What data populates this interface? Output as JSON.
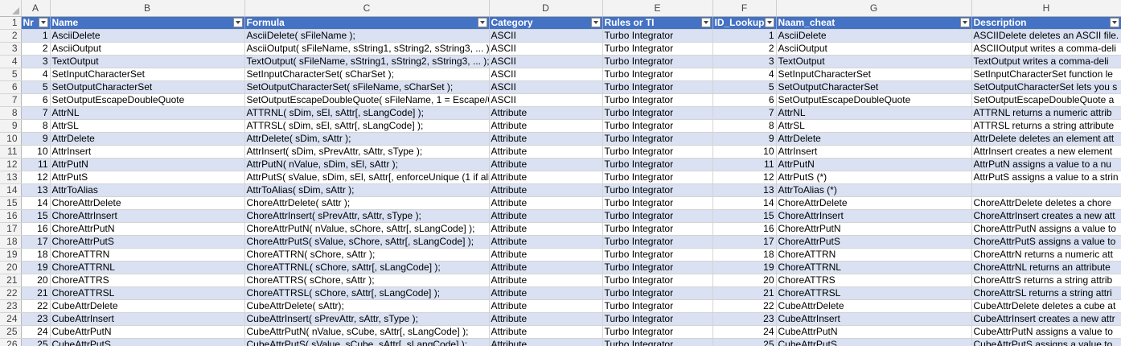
{
  "sheet": {
    "column_letters": [
      "A",
      "B",
      "C",
      "D",
      "E",
      "F",
      "G",
      "H"
    ],
    "header_row_number": "1",
    "headers": [
      "Nr",
      "Name",
      "Formula",
      "Category",
      "Rules or TI",
      "ID_Lookup",
      "Naam_cheat",
      "Description"
    ],
    "rows": [
      {
        "n": "2",
        "cells": [
          "1",
          "AsciiDelete",
          "AsciiDelete( sFileName );",
          "ASCII",
          "Turbo Integrator",
          "1",
          "AsciiDelete",
          "ASCIIDelete deletes an ASCII file."
        ]
      },
      {
        "n": "3",
        "cells": [
          "2",
          "AsciiOutput",
          "AsciiOutput( sFileName, sString1, sString2, sString3, ... );",
          "ASCII",
          "Turbo Integrator",
          "2",
          "AsciiOutput",
          "ASCIIOutput writes a comma-deli"
        ]
      },
      {
        "n": "4",
        "cells": [
          "3",
          "TextOutput",
          "TextOutput( sFileName, sString1, sString2, sString3, ... );",
          "ASCII",
          "Turbo Integrator",
          "3",
          "TextOutput",
          "TextOutput writes a comma-deli"
        ]
      },
      {
        "n": "5",
        "cells": [
          "4",
          "SetInputCharacterSet",
          "SetInputCharacterSet( sCharSet );",
          "ASCII",
          "Turbo Integrator",
          "4",
          "SetInputCharacterSet",
          "SetInputCharacterSet function le"
        ]
      },
      {
        "n": "6",
        "cells": [
          "5",
          "SetOutputCharacterSet",
          "SetOutputCharacterSet( sFileName, sCharSet );",
          "ASCII",
          "Turbo Integrator",
          "5",
          "SetOutputCharacterSet",
          "SetOutputCharacterSet lets you s"
        ]
      },
      {
        "n": "7",
        "cells": [
          "6",
          "SetOutputEscapeDoubleQuote",
          "SetOutputEscapeDoubleQuote( sFileName, 1 = Escape/0 = ",
          "ASCII",
          "Turbo Integrator",
          "6",
          "SetOutputEscapeDoubleQuote",
          "SetOutputEscapeDoubleQuote a"
        ]
      },
      {
        "n": "8",
        "cells": [
          "7",
          "AttrNL",
          "ATTRNL( sDim, sEl, sAttr[, sLangCode] );",
          "Attribute",
          "Turbo Integrator",
          "7",
          "AttrNL",
          "ATTRNL returns a numeric attrib"
        ]
      },
      {
        "n": "9",
        "cells": [
          "8",
          "AttrSL",
          "ATTRSL( sDim, sEl, sAttr[, sLangCode] );",
          "Attribute",
          "Turbo Integrator",
          "8",
          "AttrSL",
          "ATTRSL returns a string attribute"
        ]
      },
      {
        "n": "10",
        "cells": [
          "9",
          "AttrDelete",
          "AttrDelete( sDim, sAttr );",
          "Attribute",
          "Turbo Integrator",
          "9",
          "AttrDelete",
          "AttrDelete deletes an element att"
        ]
      },
      {
        "n": "11",
        "cells": [
          "10",
          "AttrInsert",
          "AttrInsert( sDim, sPrevAttr, sAttr, sType );",
          "Attribute",
          "Turbo Integrator",
          "10",
          "AttrInsert",
          "AttrInsert creates a new element"
        ]
      },
      {
        "n": "12",
        "cells": [
          "11",
          "AttrPutN",
          "AttrPutN( nValue, sDim, sEl, sAttr );",
          "Attribute",
          "Turbo Integrator",
          "11",
          "AttrPutN",
          "AttrPutN assigns a value to a nu"
        ]
      },
      {
        "n": "13",
        "cells": [
          "12",
          "AttrPutS",
          "AttrPutS( sValue, sDim, sEl, sAttr[, enforceUnique (1 if alia",
          "Attribute",
          "Turbo Integrator",
          "12",
          "AttrPutS (*)",
          "AttrPutS assigns a value to a strin"
        ]
      },
      {
        "n": "14",
        "cells": [
          "13",
          "AttrToAlias",
          "AttrToAlias( sDim, sAttr );",
          "Attribute",
          "Turbo Integrator",
          "13",
          "AttrToAlias (*)",
          ""
        ]
      },
      {
        "n": "15",
        "cells": [
          "14",
          "ChoreAttrDelete",
          "ChoreAttrDelete( sAttr );",
          "Attribute",
          "Turbo Integrator",
          "14",
          "ChoreAttrDelete",
          "ChoreAttrDelete deletes a chore"
        ]
      },
      {
        "n": "16",
        "cells": [
          "15",
          "ChoreAttrInsert",
          "ChoreAttrInsert( sPrevAttr, sAttr, sType );",
          "Attribute",
          "Turbo Integrator",
          "15",
          "ChoreAttrInsert",
          "ChoreAttrInsert creates a new att"
        ]
      },
      {
        "n": "17",
        "cells": [
          "16",
          "ChoreAttrPutN",
          "ChoreAttrPutN( nValue, sChore, sAttr[, sLangCode] );",
          "Attribute",
          "Turbo Integrator",
          "16",
          "ChoreAttrPutN",
          "ChoreAttrPutN assigns a value to"
        ]
      },
      {
        "n": "18",
        "cells": [
          "17",
          "ChoreAttrPutS",
          "ChoreAttrPutS( sValue, sChore, sAttr[, sLangCode] );",
          "Attribute",
          "Turbo Integrator",
          "17",
          "ChoreAttrPutS",
          "ChoreAttrPutS assigns a value to"
        ]
      },
      {
        "n": "19",
        "cells": [
          "18",
          "ChoreATTRN",
          "ChoreATTRN( sChore, sAttr );",
          "Attribute",
          "Turbo Integrator",
          "18",
          "ChoreATTRN",
          "ChoreAttrN returns a numeric att"
        ]
      },
      {
        "n": "20",
        "cells": [
          "19",
          "ChoreATTRNL",
          "ChoreATTRNL( sChore, sAttr[, sLangCode] );",
          "Attribute",
          "Turbo Integrator",
          "19",
          "ChoreATTRNL",
          "ChoreAttrNL returns an attribute"
        ]
      },
      {
        "n": "21",
        "cells": [
          "20",
          "ChoreATTRS",
          "ChoreATTRS( sChore, sAttr );",
          "Attribute",
          "Turbo Integrator",
          "20",
          "ChoreATTRS",
          "ChoreAttrS returns a string attrib"
        ]
      },
      {
        "n": "22",
        "cells": [
          "21",
          "ChoreATTRSL",
          "ChoreATTRSL( sChore, sAttr[, sLangCode] );",
          "Attribute",
          "Turbo Integrator",
          "21",
          "ChoreATTRSL",
          "ChoreAttrSL returns a string attri"
        ]
      },
      {
        "n": "23",
        "cells": [
          "22",
          "CubeAttrDelete",
          "CubeAttrDelete( sAttr);",
          "Attribute",
          "Turbo Integrator",
          "22",
          "CubeAttrDelete",
          "CubeAttrDelete deletes a cube at"
        ]
      },
      {
        "n": "24",
        "cells": [
          "23",
          "CubeAttrInsert",
          "CubeAttrInsert( sPrevAttr, sAttr, sType );",
          "Attribute",
          "Turbo Integrator",
          "23",
          "CubeAttrInsert",
          "CubeAttrInsert creates a new attr"
        ]
      },
      {
        "n": "25",
        "cells": [
          "24",
          "CubeAttrPutN",
          "CubeAttrPutN( nValue, sCube, sAttr[, sLangCode] );",
          "Attribute",
          "Turbo Integrator",
          "24",
          "CubeAttrPutN",
          "CubeAttrPutN assigns a value to"
        ]
      },
      {
        "n": "26",
        "cells": [
          "25",
          "CubeAttrPutS",
          "CubeAttrPutS( sValue, sCube, sAttr[, sLangCode] );",
          "Attribute",
          "Turbo Integrator",
          "25",
          "CubeAttrPutS",
          "CubeAttrPutS assigns a value to"
        ]
      }
    ]
  },
  "colors": {
    "header_fill": "#4472c4",
    "band_fill": "#d9e1f2",
    "gridline": "#d4d4d4"
  },
  "icons": {
    "filter_button": "filter-dropdown-icon",
    "select_all": "select-all-corner-icon"
  }
}
